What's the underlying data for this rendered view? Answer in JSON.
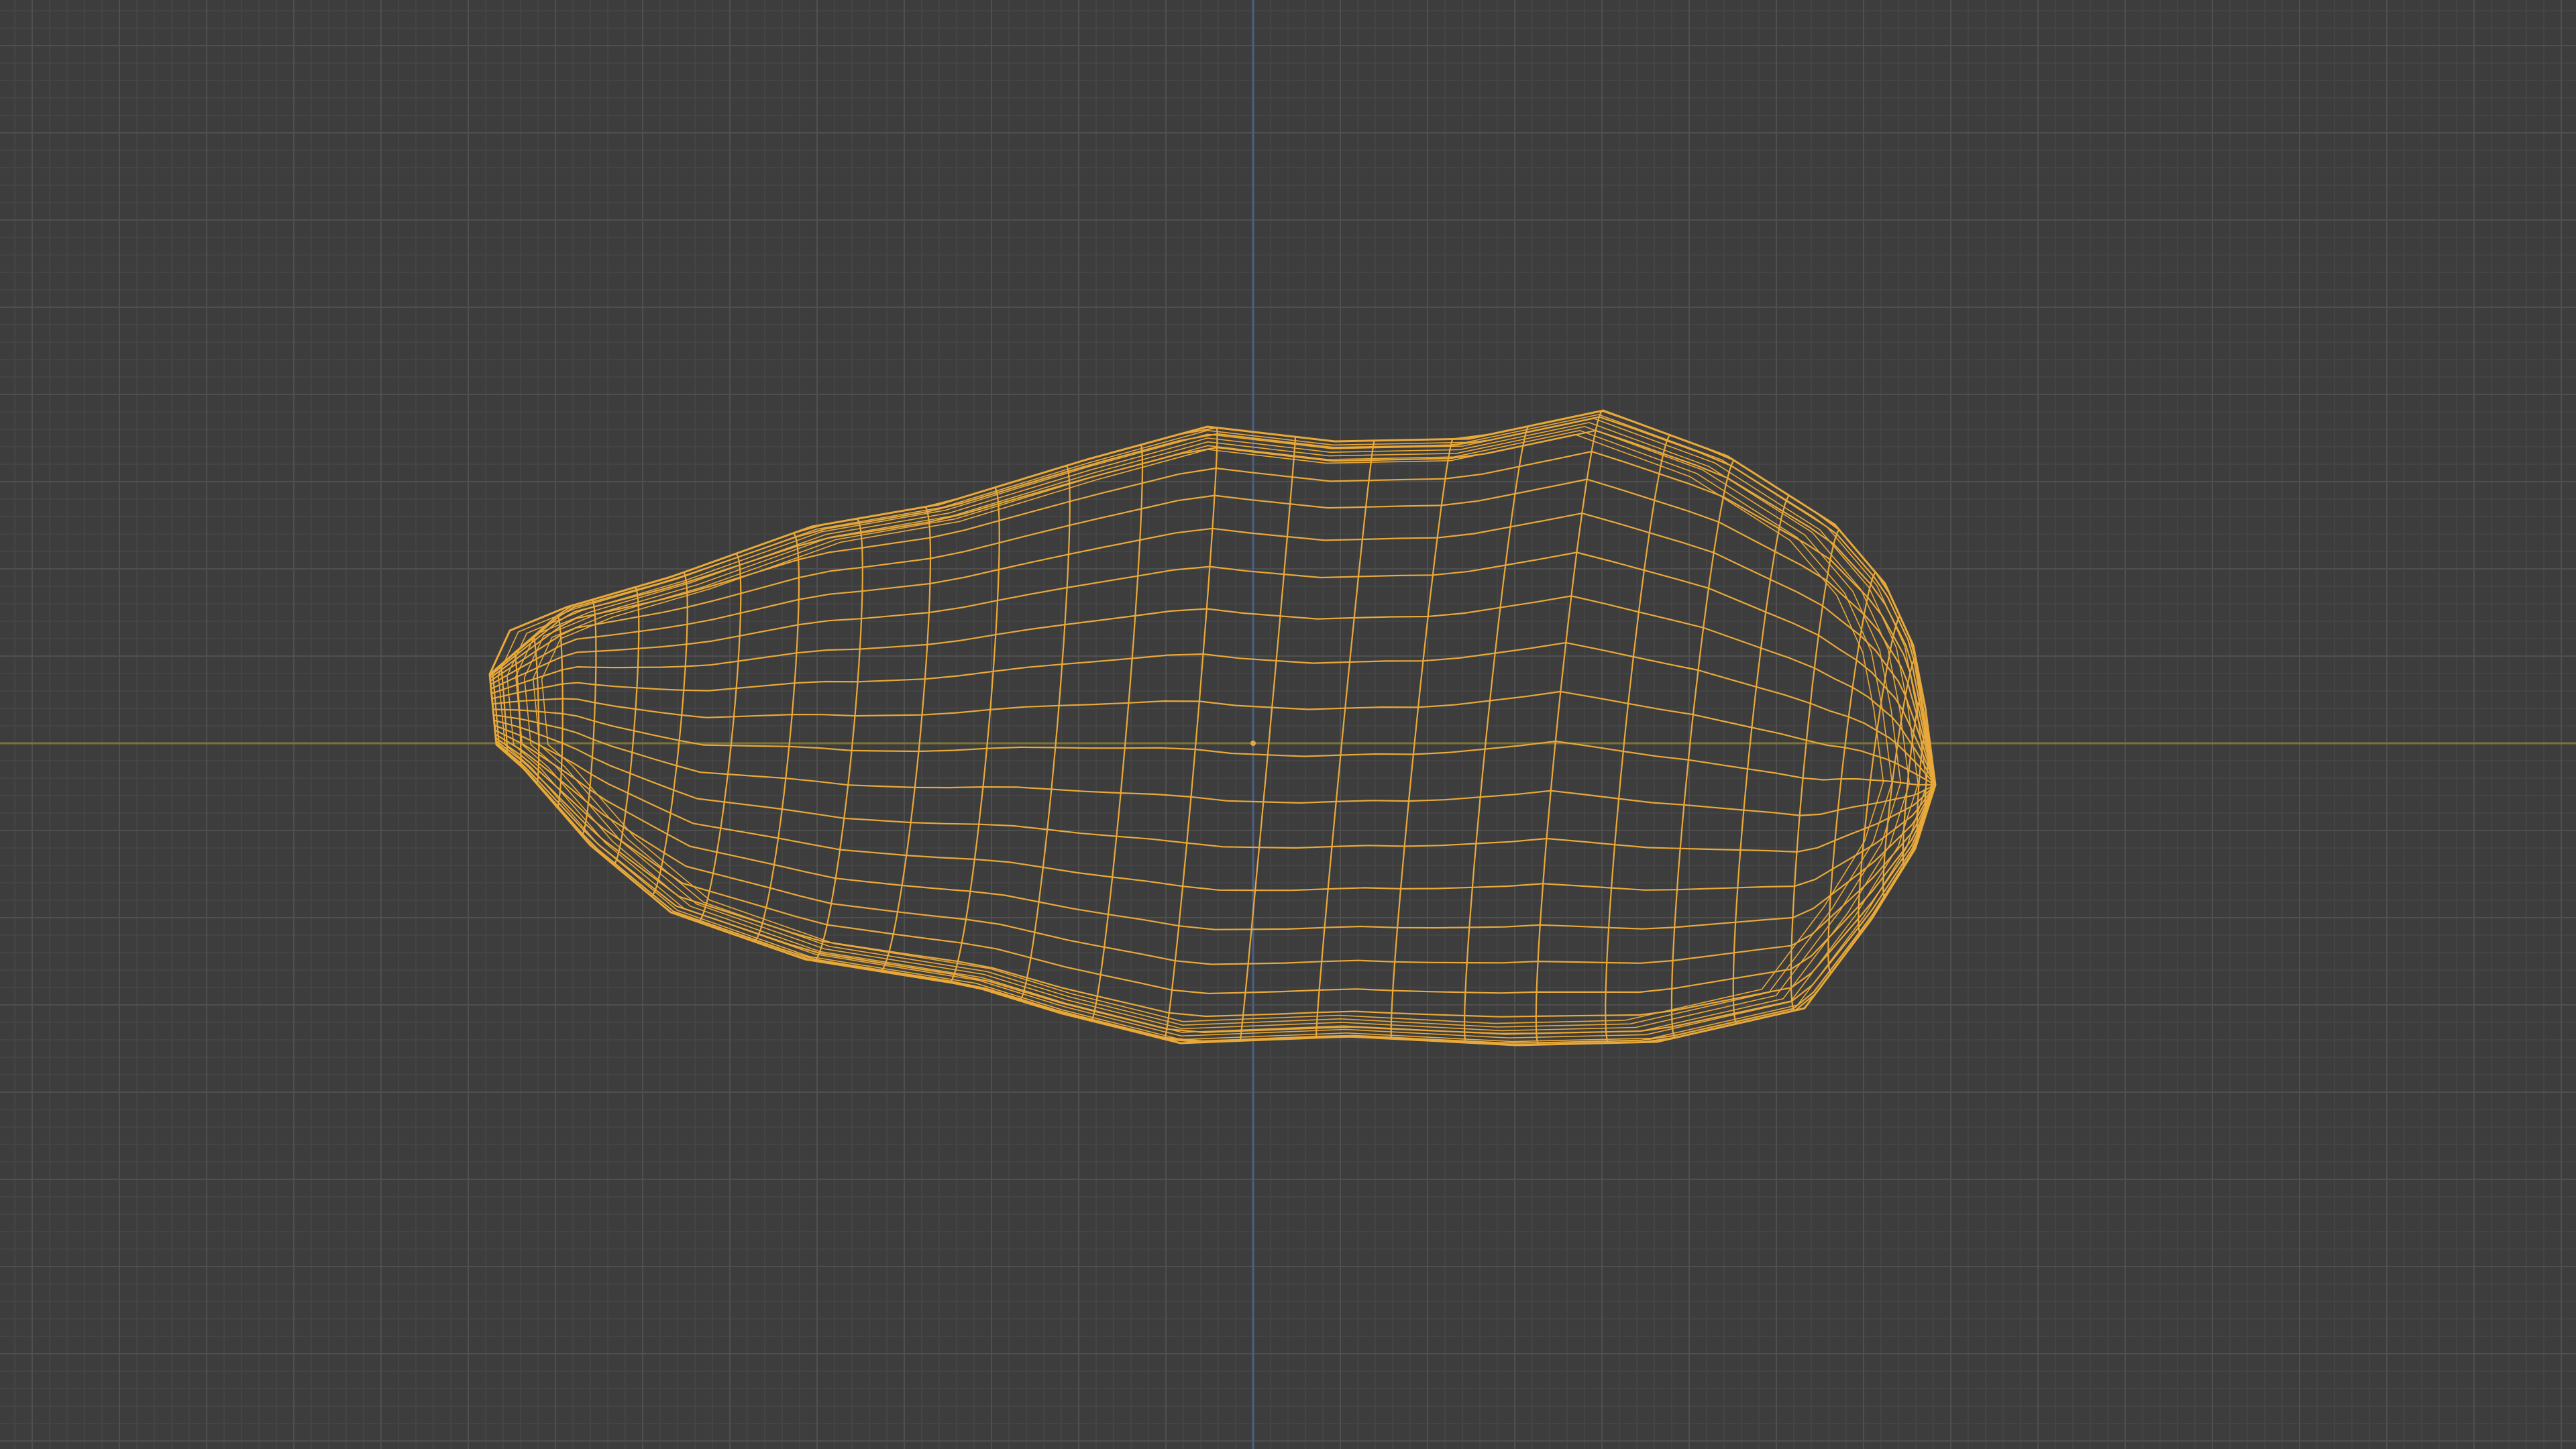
{
  "viewport": {
    "mode": "wireframe",
    "object_name": "",
    "colors": {
      "background": "#3d3d3d",
      "grid_minor": "#474747",
      "grid_major": "#4f4f4f",
      "axis_x": "#7c7434",
      "axis_y": "#4a5f86",
      "wireframe": "#e8a93a"
    },
    "icons": [
      "origin-point-icon"
    ]
  }
}
